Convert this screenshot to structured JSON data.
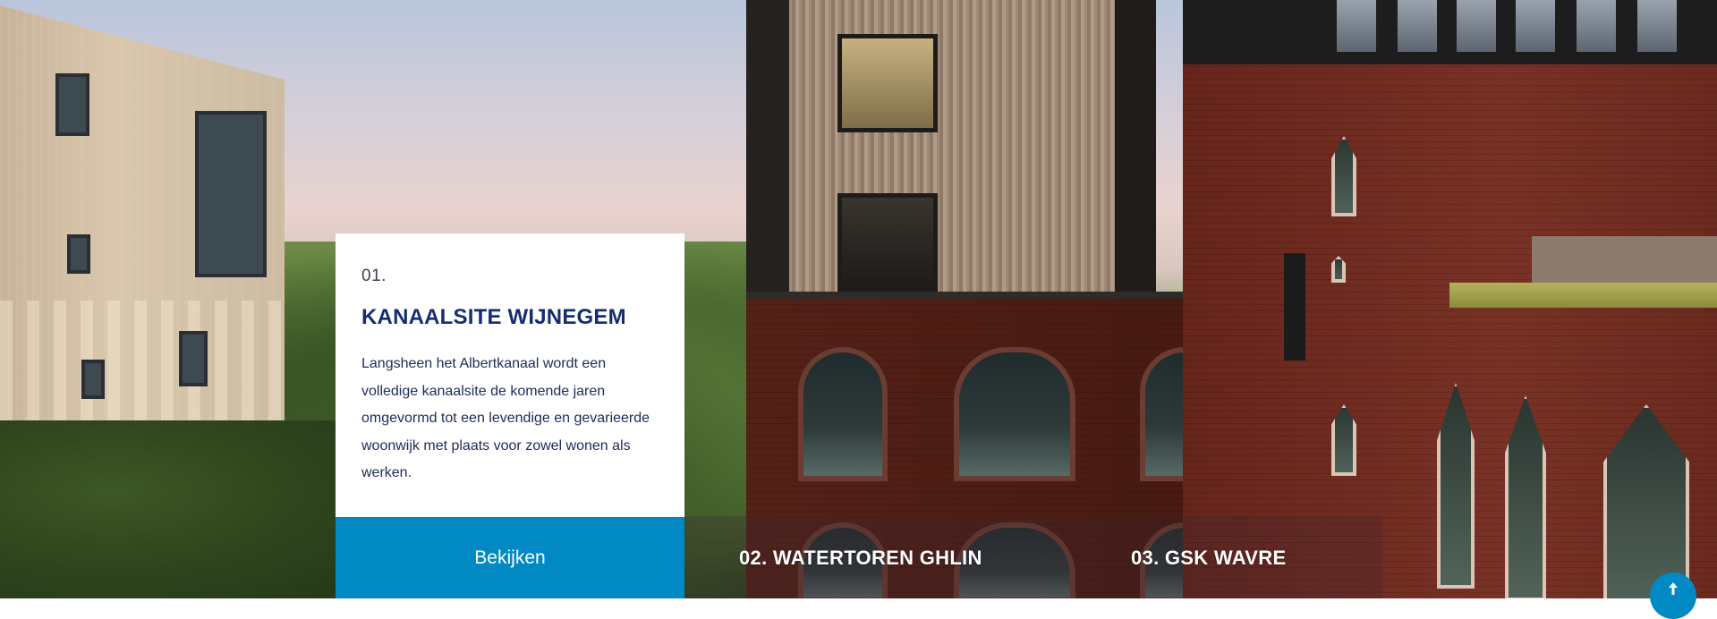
{
  "hero": {
    "active_project": {
      "number": "01.",
      "title": "KANAALSITE WIJNEGEM",
      "description": "Langsheen het Albertkanaal wordt een volledige kanaalsite de komende jaren omgevormd tot een levendige en gevarieerde woonwijk met plaats voor zowel wonen als werken.",
      "cta_label": "Bekijken"
    },
    "tabs": [
      {
        "label": "02. WATERTOREN GHLIN"
      },
      {
        "label": "03. GSK WAVRE"
      }
    ]
  },
  "scroll_top": {
    "icon": "arrow-up-icon"
  },
  "colors": {
    "accent": "#0089c2",
    "title": "#152c73",
    "body_text": "#1f2a5a",
    "card_bg": "#ffffff"
  }
}
